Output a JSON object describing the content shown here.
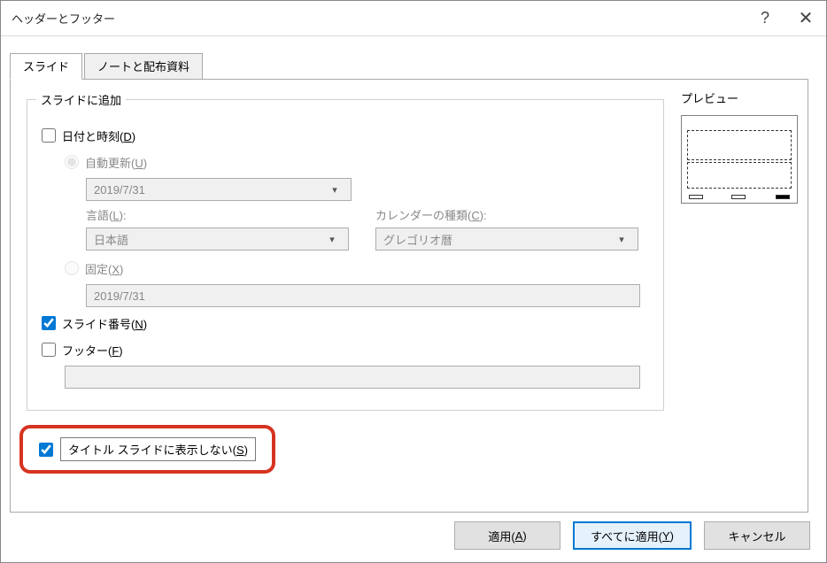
{
  "title": "ヘッダーとフッター",
  "titlebar": {
    "help": "?",
    "close": "✕"
  },
  "tabs": {
    "slide": "スライド",
    "notes": "ノートと配布資料"
  },
  "group": {
    "legend": "スライドに追加",
    "datetime": {
      "label": "日付と時刻(",
      "accel": "D",
      "suffix": ")",
      "checked": false
    },
    "auto": {
      "label": "自動更新(",
      "accel": "U",
      "suffix": ")",
      "selected": true
    },
    "autoDateValue": "2019/7/31",
    "lang": {
      "label": "言語(",
      "accel": "L",
      "suffix": "):",
      "value": "日本語"
    },
    "cal": {
      "label": "カレンダーの種類(",
      "accel": "C",
      "suffix": "):",
      "value": "グレゴリオ暦"
    },
    "fixed": {
      "label": "固定(",
      "accel": "X",
      "suffix": ")",
      "selected": false,
      "value": "2019/7/31"
    },
    "slidenum": {
      "label": "スライド番号(",
      "accel": "N",
      "suffix": ")",
      "checked": true
    },
    "footer": {
      "label": "フッター(",
      "accel": "F",
      "suffix": ")",
      "checked": false,
      "value": ""
    }
  },
  "preview": {
    "legend": "プレビュー"
  },
  "hide": {
    "label": "タイトル スライドに表示しない(",
    "accel": "S",
    "suffix": ")",
    "checked": true
  },
  "buttons": {
    "apply": {
      "label": "適用(",
      "accel": "A",
      "suffix": ")"
    },
    "applyAll": {
      "label": "すべてに適用(",
      "accel": "Y",
      "suffix": ")"
    },
    "cancel": "キャンセル"
  }
}
